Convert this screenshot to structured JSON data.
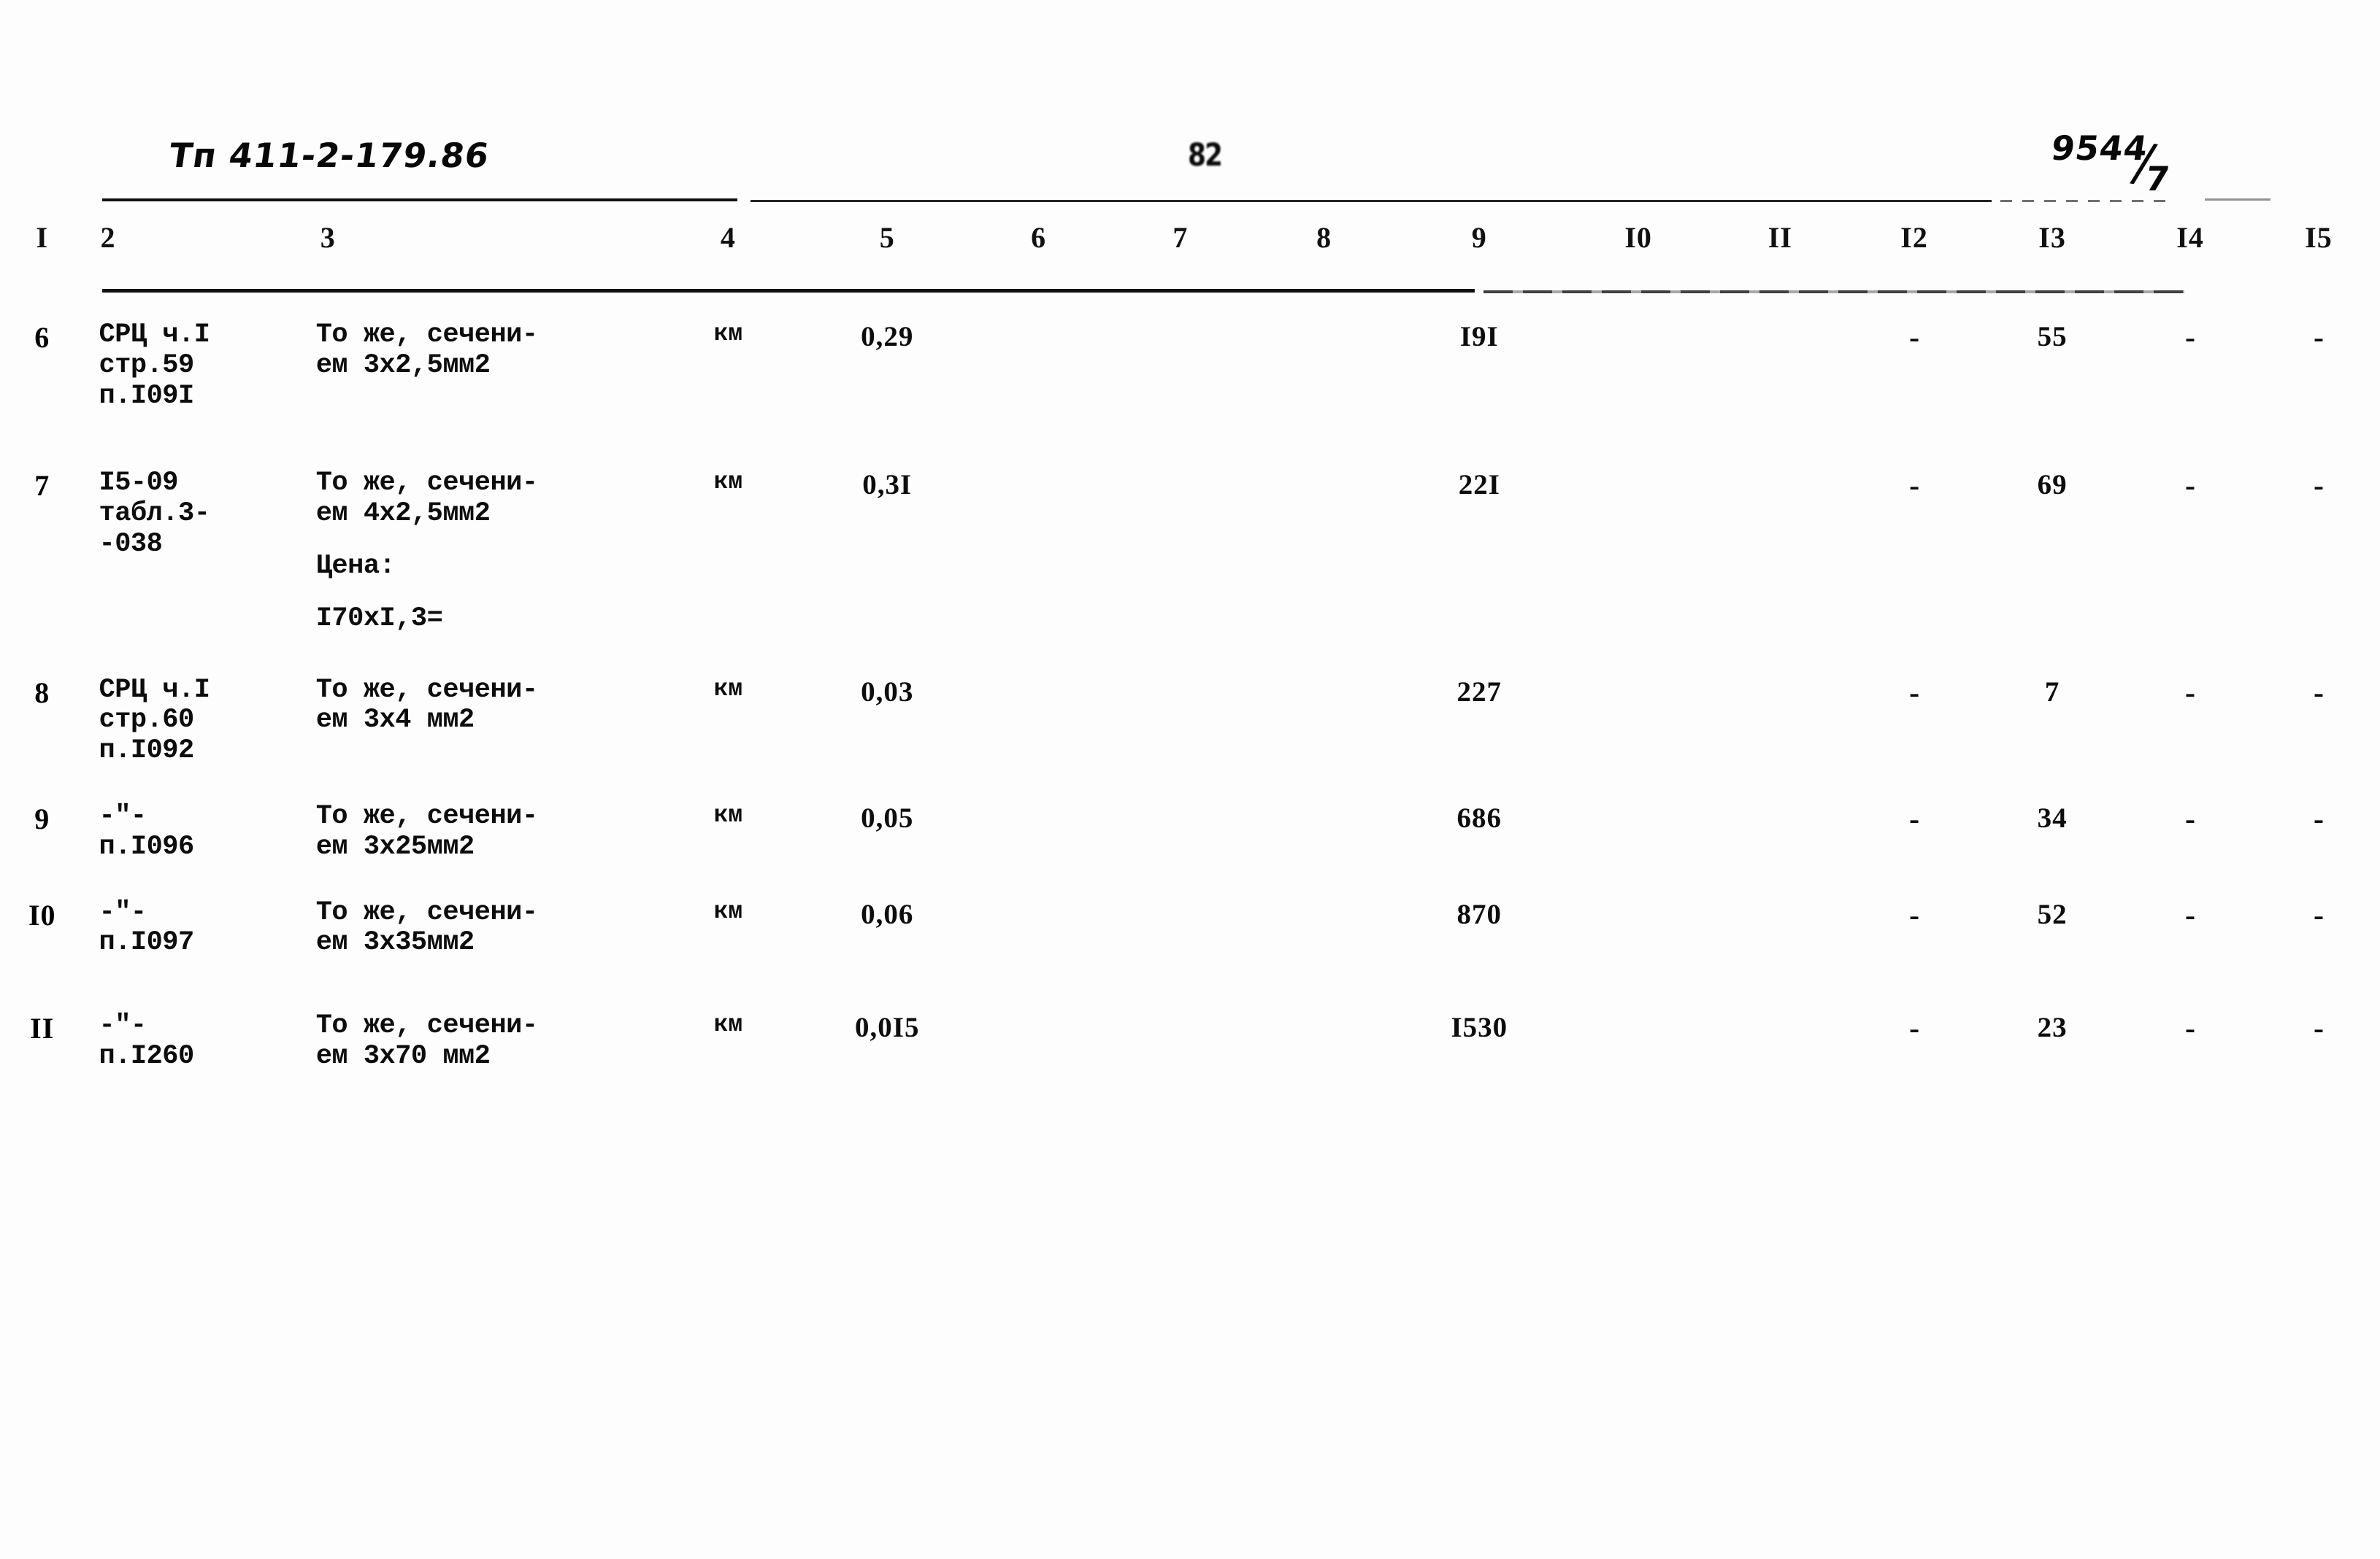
{
  "annotations": {
    "doc_code": "Тп 411-2-179.86",
    "sheet_number_num": "9544",
    "sheet_number_den": "7",
    "sheet_number_slash": "/",
    "page_number": "82"
  },
  "table": {
    "column_numbers": [
      "I",
      "2",
      "3",
      "4",
      "5",
      "6",
      "7",
      "8",
      "9",
      "I0",
      "II",
      "I2",
      "I3",
      "I4",
      "I5"
    ],
    "rows": [
      {
        "c1": "6",
        "c2": "СРЦ ч.I\nстр.59\nп.I09I",
        "c3": "То же, сечени-\nем 3х2,5мм2",
        "c4": "км",
        "c5": "0,29",
        "c6": "",
        "c7": "",
        "c8": "",
        "c9": "I9I",
        "c10": "",
        "c11": "",
        "c12": "-",
        "c13": "55",
        "c14": "-",
        "c15": "-"
      },
      {
        "c1": "7",
        "c2": "I5-09\nтабл.3-\n-038",
        "c3": "То же, сечени-\nем 4х2,5мм2",
        "c3_extra1": "Цена:",
        "c3_extra2": "I70хI,3=",
        "c4": "км",
        "c5": "0,3I",
        "c6": "",
        "c7": "",
        "c8": "",
        "c9": "22I",
        "c10": "",
        "c11": "",
        "c12": "-",
        "c13": "69",
        "c14": "-",
        "c15": "-"
      },
      {
        "c1": "8",
        "c2": "СРЦ ч.I\nстр.60\nп.I092",
        "c3": "То же, сечени-\nем 3х4 мм2",
        "c4": "км",
        "c5": "0,03",
        "c6": "",
        "c7": "",
        "c8": "",
        "c9": "227",
        "c10": "",
        "c11": "",
        "c12": "-",
        "c13": "7",
        "c14": "-",
        "c15": "-"
      },
      {
        "c1": "9",
        "c2": "-\"-\nп.I096",
        "c3": "То же, сечени-\nем 3х25мм2",
        "c4": "км",
        "c5": "0,05",
        "c6": "",
        "c7": "",
        "c8": "",
        "c9": "686",
        "c10": "",
        "c11": "",
        "c12": "-",
        "c13": "34",
        "c14": "-",
        "c15": "-"
      },
      {
        "c1": "I0",
        "c2": "-\"-\nп.I097",
        "c3": "То же, сечени-\nем 3х35мм2",
        "c4": "км",
        "c5": "0,06",
        "c6": "",
        "c7": "",
        "c8": "",
        "c9": "870",
        "c10": "",
        "c11": "",
        "c12": "-",
        "c13": "52",
        "c14": "-",
        "c15": "-"
      },
      {
        "c1": "II",
        "c2": "-\"-\nп.I260",
        "c3": "То же, сечени-\nем 3х70 мм2",
        "c4": "км",
        "c5": "0,0I5",
        "c6": "",
        "c7": "",
        "c8": "",
        "c9": "I530",
        "c10": "",
        "c11": "",
        "c12": "-",
        "c13": "23",
        "c14": "-",
        "c15": "-"
      }
    ]
  }
}
